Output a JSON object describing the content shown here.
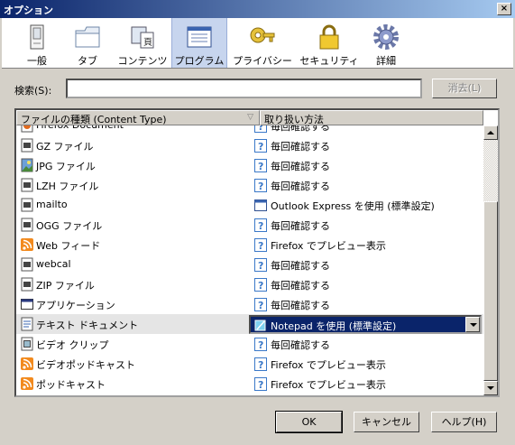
{
  "window": {
    "title": "オプション",
    "close_label": "×"
  },
  "toolbar": {
    "items": [
      {
        "label": "一般",
        "icon": "general-icon"
      },
      {
        "label": "タブ",
        "icon": "tab-icon"
      },
      {
        "label": "コンテンツ",
        "icon": "content-icon"
      },
      {
        "label": "プログラム",
        "icon": "program-icon",
        "selected": true
      },
      {
        "label": "プライバシー",
        "icon": "privacy-icon"
      },
      {
        "label": "セキュリティ",
        "icon": "lock-icon"
      },
      {
        "label": "詳細",
        "icon": "gear-icon"
      }
    ]
  },
  "search": {
    "label": "検索(S):",
    "value": "",
    "clear_label": "消去(L)"
  },
  "table": {
    "columns": [
      "ファイルの種類 (Content Type)",
      "取り扱い方法"
    ],
    "partial_row": {
      "type": "Firefox Document",
      "action": "毎回確認する"
    },
    "rows": [
      {
        "type": "GZ ファイル",
        "action": "毎回確認する",
        "icon": "file-icon",
        "action_icon": "ask-icon"
      },
      {
        "type": "JPG ファイル",
        "action": "毎回確認する",
        "icon": "image-icon",
        "action_icon": "ask-icon"
      },
      {
        "type": "LZH ファイル",
        "action": "毎回確認する",
        "icon": "file-icon",
        "action_icon": "ask-icon"
      },
      {
        "type": "mailto",
        "action": "Outlook Express を使用 (標準設定)",
        "icon": "file-icon",
        "action_icon": "app-window-icon"
      },
      {
        "type": "OGG ファイル",
        "action": "毎回確認する",
        "icon": "file-icon",
        "action_icon": "ask-icon"
      },
      {
        "type": "Web フィード",
        "action": "Firefox でプレビュー表示",
        "icon": "rss-icon",
        "action_icon": "ask-icon"
      },
      {
        "type": "webcal",
        "action": "毎回確認する",
        "icon": "file-icon",
        "action_icon": "ask-icon"
      },
      {
        "type": "ZIP ファイル",
        "action": "毎回確認する",
        "icon": "file-icon",
        "action_icon": "ask-icon"
      },
      {
        "type": "アプリケーション",
        "action": "毎回確認する",
        "icon": "app-window-icon",
        "action_icon": "ask-icon"
      },
      {
        "type": "テキスト ドキュメント",
        "action": "Notepad を使用 (標準設定)",
        "icon": "text-doc-icon",
        "action_icon": "notepad-icon",
        "selected": true
      },
      {
        "type": "ビデオ クリップ",
        "action": "毎回確認する",
        "icon": "video-icon",
        "action_icon": "ask-icon"
      },
      {
        "type": "ビデオポッドキャスト",
        "action": "Firefox でプレビュー表示",
        "icon": "rss-icon",
        "action_icon": "ask-icon"
      },
      {
        "type": "ポッドキャスト",
        "action": "Firefox でプレビュー表示",
        "icon": "rss-icon",
        "action_icon": "ask-icon"
      }
    ]
  },
  "buttons": {
    "ok": "OK",
    "cancel": "キャンセル",
    "help": "ヘルプ(H)"
  },
  "colors": {
    "selection": "#0a246a",
    "rss": "#f28a1e",
    "ask": "#3a78c8"
  }
}
